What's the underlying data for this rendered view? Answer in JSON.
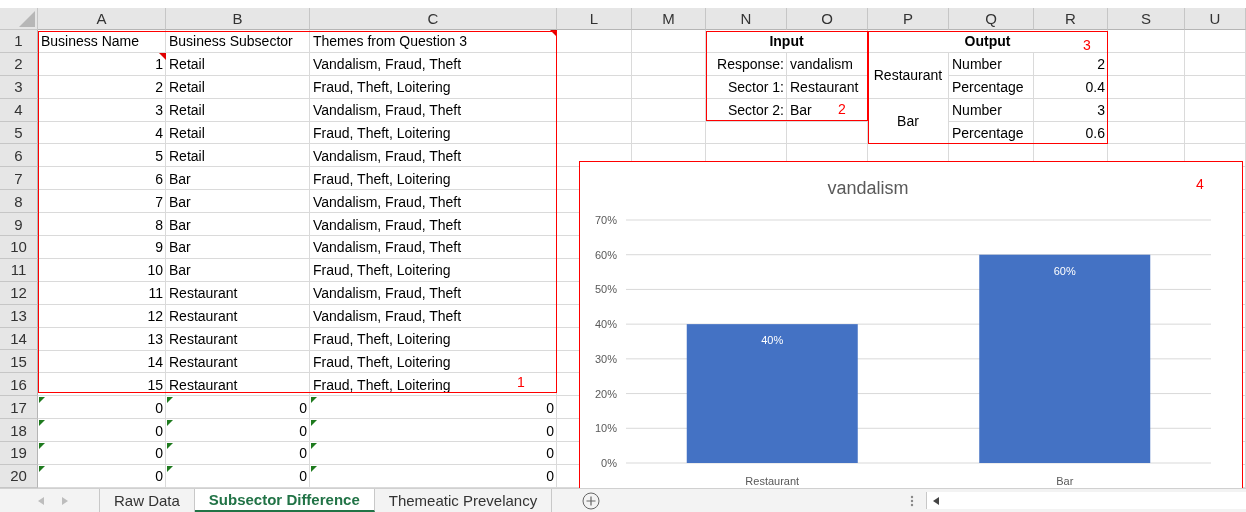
{
  "column_headers": [
    "A",
    "B",
    "C",
    "L",
    "M",
    "N",
    "O",
    "P",
    "Q",
    "R",
    "S",
    "U"
  ],
  "row_headers": [
    "1",
    "2",
    "3",
    "4",
    "5",
    "6",
    "7",
    "8",
    "9",
    "10",
    "11",
    "12",
    "13",
    "14",
    "15",
    "16",
    "17",
    "18",
    "19",
    "20"
  ],
  "main_table": {
    "header": [
      {
        "text": "Business Name",
        "comment": false
      },
      {
        "text": "Business Subsector",
        "comment": false
      },
      {
        "text": "Themes from Question 3",
        "comment": true
      }
    ],
    "rows": [
      {
        "name": "1",
        "subsector": "Retail",
        "themes": "Vandalism, Fraud, Theft",
        "comment": true
      },
      {
        "name": "2",
        "subsector": "Retail",
        "themes": "Fraud, Theft, Loitering",
        "comment": false
      },
      {
        "name": "3",
        "subsector": "Retail",
        "themes": "Vandalism, Fraud, Theft",
        "comment": false
      },
      {
        "name": "4",
        "subsector": "Retail",
        "themes": "Fraud, Theft, Loitering",
        "comment": false
      },
      {
        "name": "5",
        "subsector": "Retail",
        "themes": "Vandalism, Fraud, Theft",
        "comment": false
      },
      {
        "name": "6",
        "subsector": "Bar",
        "themes": "Fraud, Theft, Loitering",
        "comment": false
      },
      {
        "name": "7",
        "subsector": "Bar",
        "themes": "Vandalism, Fraud, Theft",
        "comment": false
      },
      {
        "name": "8",
        "subsector": "Bar",
        "themes": "Vandalism, Fraud, Theft",
        "comment": false
      },
      {
        "name": "9",
        "subsector": "Bar",
        "themes": "Vandalism, Fraud, Theft",
        "comment": false
      },
      {
        "name": "10",
        "subsector": "Bar",
        "themes": "Fraud, Theft, Loitering",
        "comment": false
      },
      {
        "name": "11",
        "subsector": "Restaurant",
        "themes": "Vandalism, Fraud, Theft",
        "comment": false
      },
      {
        "name": "12",
        "subsector": "Restaurant",
        "themes": "Vandalism, Fraud, Theft",
        "comment": false
      },
      {
        "name": "13",
        "subsector": "Restaurant",
        "themes": "Fraud, Theft, Loitering",
        "comment": false
      },
      {
        "name": "14",
        "subsector": "Restaurant",
        "themes": "Fraud, Theft, Loitering",
        "comment": false
      },
      {
        "name": "15",
        "subsector": "Restaurant",
        "themes": "Fraud, Theft, Loitering",
        "comment": false
      }
    ]
  },
  "formula_rows": [
    {
      "values": [
        "0",
        "0",
        "0"
      ],
      "flagged": true
    },
    {
      "values": [
        "0",
        "0",
        "0"
      ],
      "flagged": true
    },
    {
      "values": [
        "0",
        "0",
        "0"
      ],
      "flagged": true
    },
    {
      "values": [
        "0",
        "0",
        "0"
      ],
      "flagged": true
    }
  ],
  "input": {
    "title": "Input",
    "fields": [
      {
        "label": "Response:",
        "value": "vandalism"
      },
      {
        "label": "Sector 1:",
        "value": "Restaurant"
      },
      {
        "label": "Sector 2:",
        "value": "Bar"
      }
    ]
  },
  "output": {
    "title": "Output",
    "groups": [
      {
        "sector": "Restaurant",
        "metrics": [
          {
            "label": "Number",
            "value": "2"
          },
          {
            "label": "Percentage",
            "value": "0.4"
          }
        ]
      },
      {
        "sector": "Bar",
        "metrics": [
          {
            "label": "Number",
            "value": "3"
          },
          {
            "label": "Percentage",
            "value": "0.6"
          }
        ]
      }
    ]
  },
  "annotations": [
    "1",
    "2",
    "3",
    "4"
  ],
  "chart": {
    "chart_data": {
      "type": "bar",
      "title": "vandalism",
      "categories": [
        "Restaurant",
        "Bar"
      ],
      "series": [
        {
          "color": "#4472c4",
          "values": [
            0.4,
            0.6
          ]
        }
      ],
      "ylim": [
        0,
        0.7
      ],
      "yticks": [
        {
          "value": 0,
          "label": "0%"
        },
        {
          "value": 0.1,
          "label": "10%"
        },
        {
          "value": 0.2,
          "label": "20%"
        },
        {
          "value": 0.3,
          "label": "30%"
        },
        {
          "value": 0.4,
          "label": "40%"
        },
        {
          "value": 0.5,
          "label": "50%"
        },
        {
          "value": 0.6,
          "label": "60%"
        },
        {
          "value": 0.7,
          "label": "70%"
        }
      ],
      "value_labels": [
        "40%",
        "60%"
      ],
      "grid": true
    }
  },
  "sheet_tabs": [
    {
      "label": "Raw Data",
      "selected": false
    },
    {
      "label": "Subsector Difference",
      "selected": true
    },
    {
      "label": "Themeatic Prevelancy",
      "selected": false
    }
  ]
}
